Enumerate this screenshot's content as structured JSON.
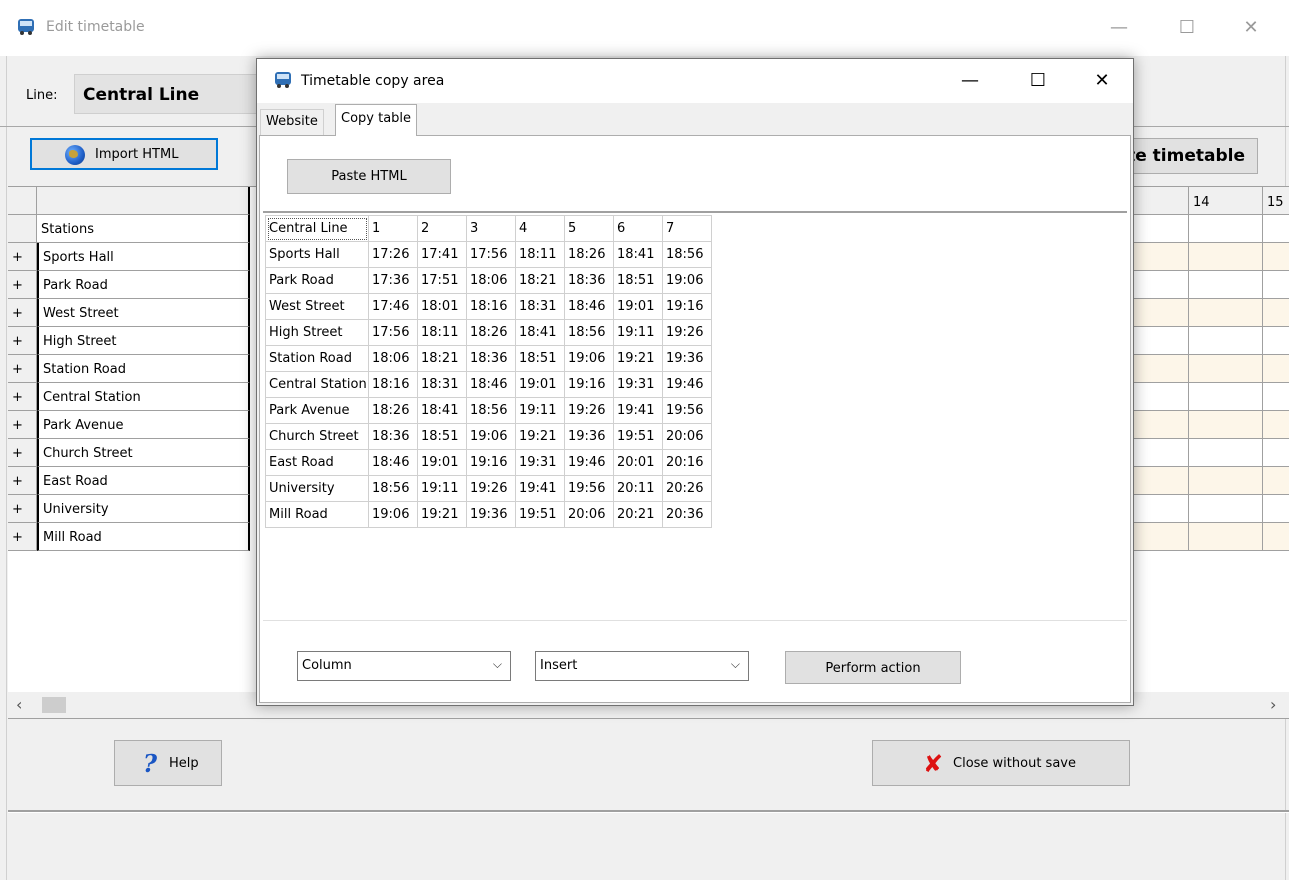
{
  "window": {
    "title": "Edit timetable",
    "minimize": "—",
    "maximize": "☐",
    "close": "✕"
  },
  "header": {
    "line_label": "Line:",
    "line_value": "Central Line",
    "import_label": "Import HTML",
    "timetable_button": "te timetable"
  },
  "grid": {
    "stations_header": "Stations",
    "col_13": "3",
    "col_14": "14",
    "col_15": "15",
    "rows": [
      {
        "expander": "+",
        "station": "Sports Hall"
      },
      {
        "expander": "+",
        "station": "Park Road"
      },
      {
        "expander": "+",
        "station": "West Street"
      },
      {
        "expander": "+",
        "station": "High Street"
      },
      {
        "expander": "+",
        "station": "Station Road"
      },
      {
        "expander": "+",
        "station": "Central Station"
      },
      {
        "expander": "+",
        "station": "Park Avenue"
      },
      {
        "expander": "+",
        "station": "Church Street"
      },
      {
        "expander": "+",
        "station": "East Road"
      },
      {
        "expander": "+",
        "station": "University"
      },
      {
        "expander": "+",
        "station": "Mill Road"
      }
    ],
    "scroll_left": "‹",
    "scroll_right": "›"
  },
  "footer": {
    "help_label": "Help",
    "close_label": "Close without save"
  },
  "dialog": {
    "title": "Timetable copy area",
    "minimize": "—",
    "maximize": "☐",
    "close": "✕",
    "tabs": [
      "Website",
      "Copy table"
    ],
    "paste_label": "Paste HTML",
    "table": {
      "header": [
        "Central Line",
        "1",
        "2",
        "3",
        "4",
        "5",
        "6",
        "7"
      ],
      "rows": [
        [
          "Sports Hall",
          "17:26",
          "17:41",
          "17:56",
          "18:11",
          "18:26",
          "18:41",
          "18:56"
        ],
        [
          "Park Road",
          "17:36",
          "17:51",
          "18:06",
          "18:21",
          "18:36",
          "18:51",
          "19:06"
        ],
        [
          "West Street",
          "17:46",
          "18:01",
          "18:16",
          "18:31",
          "18:46",
          "19:01",
          "19:16"
        ],
        [
          "High Street",
          "17:56",
          "18:11",
          "18:26",
          "18:41",
          "18:56",
          "19:11",
          "19:26"
        ],
        [
          "Station Road",
          "18:06",
          "18:21",
          "18:36",
          "18:51",
          "19:06",
          "19:21",
          "19:36"
        ],
        [
          "Central Station",
          "18:16",
          "18:31",
          "18:46",
          "19:01",
          "19:16",
          "19:31",
          "19:46"
        ],
        [
          "Park Avenue",
          "18:26",
          "18:41",
          "18:56",
          "19:11",
          "19:26",
          "19:41",
          "19:56"
        ],
        [
          "Church Street",
          "18:36",
          "18:51",
          "19:06",
          "19:21",
          "19:36",
          "19:51",
          "20:06"
        ],
        [
          "East Road",
          "18:46",
          "19:01",
          "19:16",
          "19:31",
          "19:46",
          "20:01",
          "20:16"
        ],
        [
          "University",
          "18:56",
          "19:11",
          "19:26",
          "19:41",
          "19:56",
          "20:11",
          "20:26"
        ],
        [
          "Mill Road",
          "19:06",
          "19:21",
          "19:36",
          "19:51",
          "20:06",
          "20:21",
          "20:36"
        ]
      ]
    },
    "select_target": "Column",
    "select_action": "Insert",
    "chevron": "⌵",
    "perform_label": "Perform action"
  },
  "colors": {
    "row_tint": "#fdf6e9",
    "focus_blue": "#0078d7"
  }
}
